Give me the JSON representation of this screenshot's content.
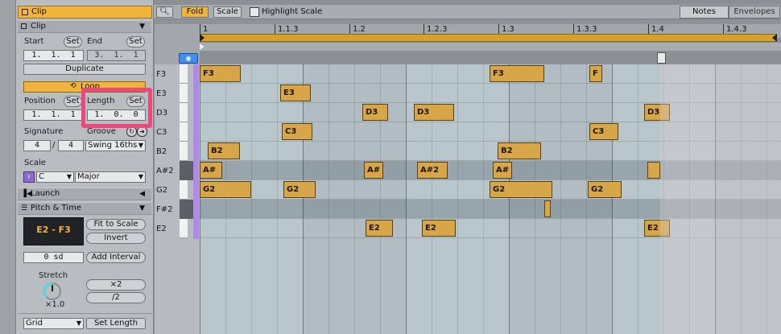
{
  "clip": {
    "title": "Clip",
    "section_clip": "Clip",
    "start_label": "Start",
    "end_label": "End",
    "set_label": "Set",
    "start_value": "1.  1.  1",
    "end_value": "3.  1.  1",
    "duplicate_label": "Duplicate",
    "loop_label": "Loop",
    "position_label": "Position",
    "length_label": "Length",
    "position_value": "1.  1.  1",
    "length_value": "1.  0.  0",
    "signature_label": "Signature",
    "groove_label": "Groove",
    "sig_num": "4",
    "sig_sep": "/",
    "sig_den": "4",
    "groove_value": "Swing 16ths",
    "scale_label": "Scale",
    "scale_root": "C",
    "scale_mode": "Major",
    "launch_label": "Launch",
    "pitch_time_label": "Pitch & Time",
    "range_display": "E2 - F3",
    "fit_to_scale": "Fit to Scale",
    "invert": "Invert",
    "transpose_value": "0 sd",
    "add_interval": "Add Interval",
    "stretch_label": "Stretch",
    "stretch_value": "×1.0",
    "times2": "×2",
    "div2": "/2",
    "grid_value": "Grid",
    "set_length": "Set Length"
  },
  "toolbar": {
    "fold": "Fold",
    "scale": "Scale",
    "highlight_scale": "Highlight Scale",
    "notes_tab": "Notes",
    "envelopes_tab": "Envelopes"
  },
  "ruler": {
    "labels": [
      "1",
      "1.1.3",
      "1.2",
      "1.2.3",
      "1.3",
      "1.3.3",
      "1.4",
      "1.4.3"
    ]
  },
  "piano": {
    "rows": [
      "F3",
      "E3",
      "D3",
      "C3",
      "B2",
      "A#2",
      "G2",
      "F#2",
      "E2"
    ]
  },
  "notes": [
    {
      "label": "F3",
      "row": 0,
      "start": 0.0,
      "length": 0.1
    },
    {
      "label": "F3",
      "row": 0,
      "start": 0.7031,
      "length": 0.1328
    },
    {
      "label": "F",
      "row": 0,
      "start": 0.9453,
      "length": 0.0313
    },
    {
      "label": "E3",
      "row": 1,
      "start": 0.1953,
      "length": 0.0742
    },
    {
      "label": "D3",
      "row": 2,
      "start": 0.3945,
      "length": 0.0625
    },
    {
      "label": "D3",
      "row": 2,
      "start": 0.5195,
      "length": 0.0977
    },
    {
      "label": "D3",
      "row": 2,
      "start": 1.0781,
      "length": 0.0625
    },
    {
      "label": "C3",
      "row": 3,
      "start": 0.1992,
      "length": 0.0742
    },
    {
      "label": "C3",
      "row": 3,
      "start": 0.9453,
      "length": 0.0703
    },
    {
      "label": "B2",
      "row": 4,
      "start": 0.0195,
      "length": 0.0781
    },
    {
      "label": "B2",
      "row": 4,
      "start": 0.7227,
      "length": 0.1055
    },
    {
      "label": "A#",
      "row": 5,
      "start": 0.0,
      "length": 0.0547
    },
    {
      "label": "A#",
      "row": 5,
      "start": 0.3984,
      "length": 0.0469
    },
    {
      "label": "A#2",
      "row": 5,
      "start": 0.5273,
      "length": 0.0742
    },
    {
      "label": "A#",
      "row": 5,
      "start": 0.7109,
      "length": 0.0469
    },
    {
      "label": "",
      "row": 5,
      "start": 1.0859,
      "length": 0.0312
    },
    {
      "label": "G2",
      "row": 6,
      "start": 0.0,
      "length": 0.125
    },
    {
      "label": "G2",
      "row": 6,
      "start": 0.2031,
      "length": 0.0781
    },
    {
      "label": "G2",
      "row": 6,
      "start": 0.7031,
      "length": 0.1523
    },
    {
      "label": "G2",
      "row": 6,
      "start": 0.9414,
      "length": 0.082
    },
    {
      "label": "",
      "row": 7,
      "start": 0.8359,
      "length": 0.0156
    },
    {
      "label": "E2",
      "row": 8,
      "start": 0.4023,
      "length": 0.0664
    },
    {
      "label": "E2",
      "row": 8,
      "start": 0.5391,
      "length": 0.082
    },
    {
      "label": "E2",
      "row": 8,
      "start": 1.0781,
      "length": 0.0625
    }
  ],
  "colors": {
    "note_fill": "#d7a648",
    "accent": "#f0b43c",
    "highlight": "#f0477a",
    "velocity_strip": "#b08ae8"
  }
}
